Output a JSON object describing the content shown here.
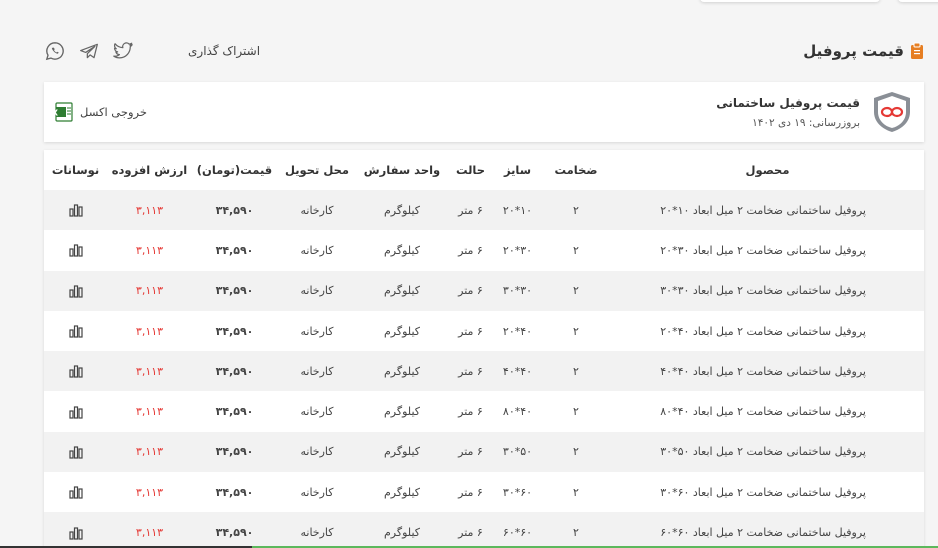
{
  "header": {
    "title": "قیمت پروفیل",
    "share_label": "اشتراک گذاری",
    "accent_color": "#e67e22"
  },
  "share_icons": [
    "linkedin-icon",
    "twitter-icon",
    "telegram-icon",
    "whatsapp-icon"
  ],
  "card": {
    "title": "قیمت پروفیل ساختمانی",
    "updated": "بروزرسانی: ۱۹ دی ۱۴۰۲",
    "export_label": "خروجی اکسل"
  },
  "table": {
    "columns": [
      "محصول",
      "ضخامت",
      "سایز",
      "حالت",
      "واحد سفارش",
      "محل تحویل",
      "قیمت(تومان)",
      "ارزش افزوده",
      "نوسانات"
    ],
    "rows": [
      {
        "product": "پروفیل ساختمانی ضخامت ۲ میل ابعاد ۱۰*۲۰",
        "thickness": "۲",
        "size": "۱۰*۲۰",
        "state": "۶ متر",
        "unit": "کیلوگرم",
        "location": "کارخانه",
        "price": "۳۴,۵۹۰",
        "vat": "۳,۱۱۳"
      },
      {
        "product": "پروفیل ساختمانی ضخامت ۲ میل ابعاد ۳۰*۲۰",
        "thickness": "۲",
        "size": "۳۰*۲۰",
        "state": "۶ متر",
        "unit": "کیلوگرم",
        "location": "کارخانه",
        "price": "۳۴,۵۹۰",
        "vat": "۳,۱۱۳"
      },
      {
        "product": "پروفیل ساختمانی ضخامت ۲ میل ابعاد ۳۰*۳۰",
        "thickness": "۲",
        "size": "۳۰*۳۰",
        "state": "۶ متر",
        "unit": "کیلوگرم",
        "location": "کارخانه",
        "price": "۳۴,۵۹۰",
        "vat": "۳,۱۱۳"
      },
      {
        "product": "پروفیل ساختمانی ضخامت ۲ میل ابعاد ۴۰*۲۰",
        "thickness": "۲",
        "size": "۴۰*۲۰",
        "state": "۶ متر",
        "unit": "کیلوگرم",
        "location": "کارخانه",
        "price": "۳۴,۵۹۰",
        "vat": "۳,۱۱۳"
      },
      {
        "product": "پروفیل ساختمانی ضخامت ۲ میل ابعاد ۴۰*۴۰",
        "thickness": "۲",
        "size": "۴۰*۴۰",
        "state": "۶ متر",
        "unit": "کیلوگرم",
        "location": "کارخانه",
        "price": "۳۴,۵۹۰",
        "vat": "۳,۱۱۳"
      },
      {
        "product": "پروفیل ساختمانی ضخامت ۲ میل ابعاد ۴۰*۸۰",
        "thickness": "۲",
        "size": "۴۰*۸۰",
        "state": "۶ متر",
        "unit": "کیلوگرم",
        "location": "کارخانه",
        "price": "۳۴,۵۹۰",
        "vat": "۳,۱۱۳"
      },
      {
        "product": "پروفیل ساختمانی ضخامت ۲ میل ابعاد ۵۰*۳۰",
        "thickness": "۲",
        "size": "۵۰*۳۰",
        "state": "۶ متر",
        "unit": "کیلوگرم",
        "location": "کارخانه",
        "price": "۳۴,۵۹۰",
        "vat": "۳,۱۱۳"
      },
      {
        "product": "پروفیل ساختمانی ضخامت ۲ میل ابعاد ۶۰*۳۰",
        "thickness": "۲",
        "size": "۶۰*۳۰",
        "state": "۶ متر",
        "unit": "کیلوگرم",
        "location": "کارخانه",
        "price": "۳۴,۵۹۰",
        "vat": "۳,۱۱۳"
      },
      {
        "product": "پروفیل ساختمانی ضخامت ۲ میل ابعاد ۶۰*۶۰",
        "thickness": "۲",
        "size": "۶۰*۶۰",
        "state": "۶ متر",
        "unit": "کیلوگرم",
        "location": "کارخانه",
        "price": "۳۴,۵۹۰",
        "vat": "۳,۱۱۳"
      }
    ],
    "vat_color": "#e53935"
  }
}
